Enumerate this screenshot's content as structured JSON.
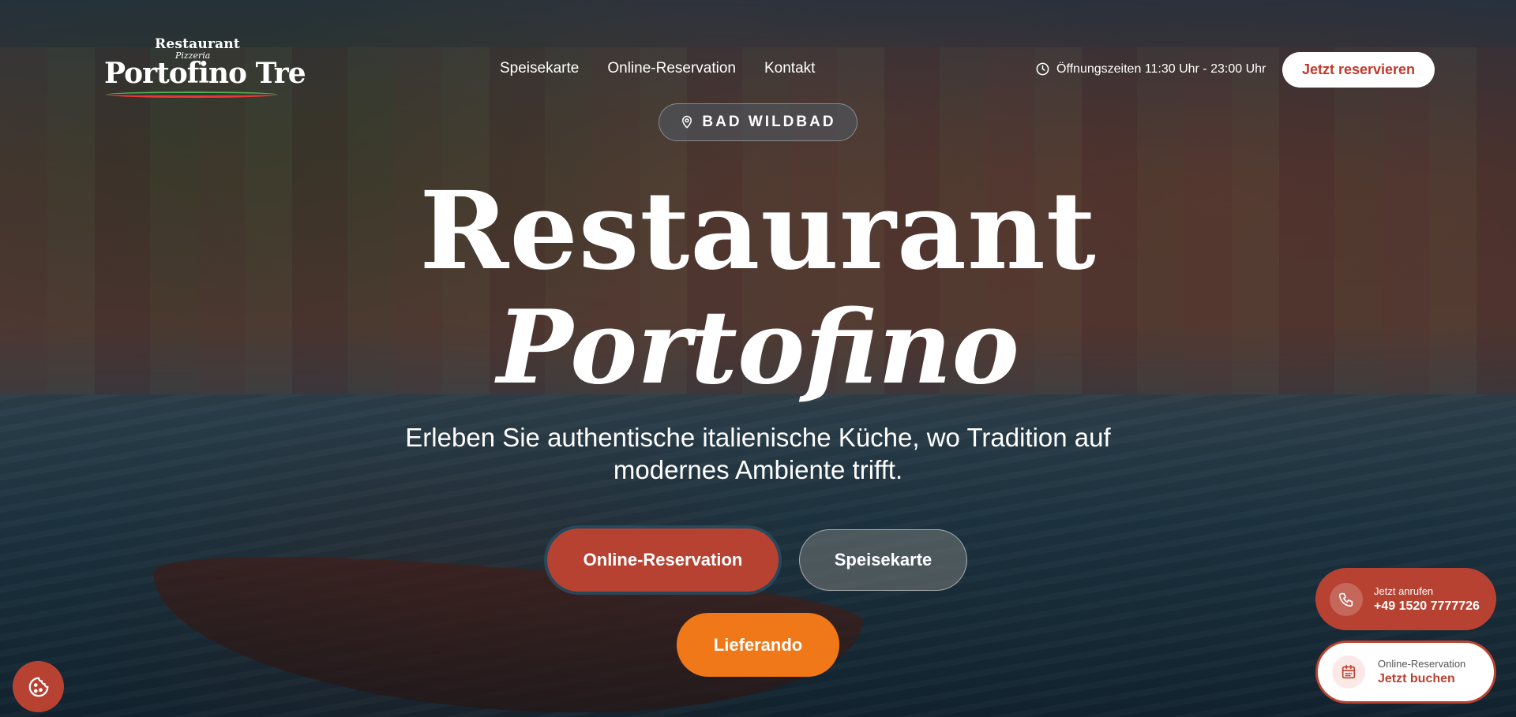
{
  "logo": {
    "top_line": "Restaurant",
    "sub_line": "Pizzeria",
    "main_line": "Portofino Tre"
  },
  "nav": {
    "items": [
      {
        "label": "Speisekarte"
      },
      {
        "label": "Online-Reservation"
      },
      {
        "label": "Kontakt"
      }
    ]
  },
  "header": {
    "hours": "Öffnungszeiten 11:30 Uhr - 23:00 Uhr",
    "reserve_button": "Jetzt reservieren"
  },
  "hero": {
    "location": "BAD WILDBAD",
    "title_line1": "Restaurant",
    "title_line2": "Portofino",
    "subtitle": "Erleben Sie authentische italienische Küche, wo Tradition auf modernes Ambiente trifft.",
    "buttons": {
      "reservation": "Online-Reservation",
      "menu": "Speisekarte",
      "delivery": "Lieferando"
    }
  },
  "floating": {
    "call": {
      "label": "Jetzt anrufen",
      "phone": "+49 1520 7777726"
    },
    "booking": {
      "label": "Online-Reservation",
      "action": "Jetzt buchen"
    }
  },
  "icons": {
    "clock": "clock-icon",
    "location": "map-pin-icon",
    "phone": "phone-icon",
    "calendar": "calendar-icon",
    "cookie": "cookie-icon"
  },
  "colors": {
    "accent_red": "#b84232",
    "delivery_orange": "#f07818",
    "white": "#ffffff"
  }
}
